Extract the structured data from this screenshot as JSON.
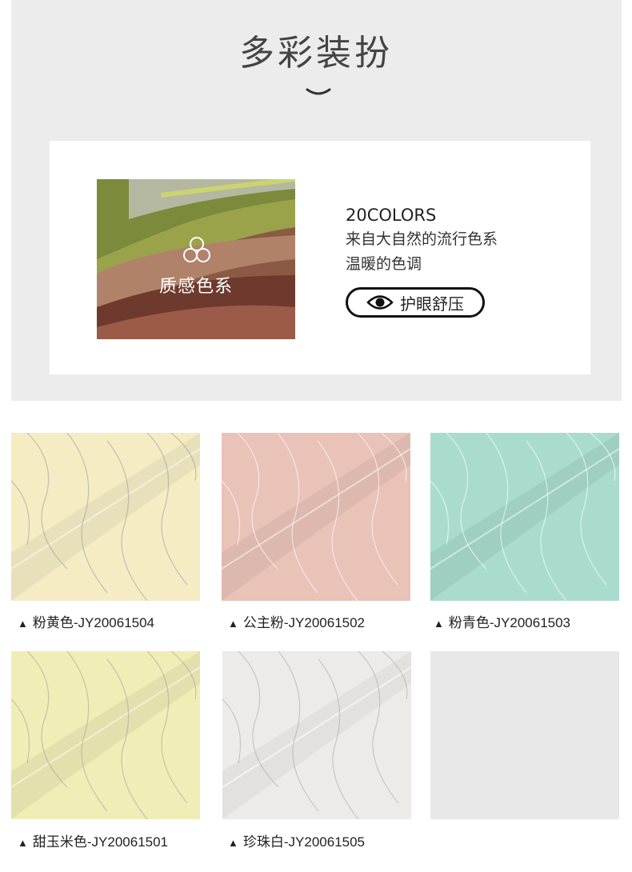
{
  "header": {
    "title": "多彩装扮",
    "chevron_icon": "chevron-down-icon"
  },
  "feature": {
    "image_label": "质感色系",
    "image_icon": "three-circles-icon",
    "colors_count": "20COLORS",
    "line1": "来自大自然的流行色系",
    "line2": "温暖的色调",
    "eye_icon": "eye-icon",
    "eye_button_label": "护眼舒压"
  },
  "products": [
    {
      "name": "粉黄色-JY20061504",
      "marker": "▲",
      "color": "#f5ecc4"
    },
    {
      "name": "公主粉-JY20061502",
      "marker": "▲",
      "color": "#e9c2b8"
    },
    {
      "name": "粉青色-JY20061503",
      "marker": "▲",
      "color": "#a9dccf"
    },
    {
      "name": "甜玉米色-JY20061501",
      "marker": "▲",
      "color": "#f1edb7"
    },
    {
      "name": "珍珠白-JY20061505",
      "marker": "▲",
      "color": "#ecebe8"
    }
  ]
}
